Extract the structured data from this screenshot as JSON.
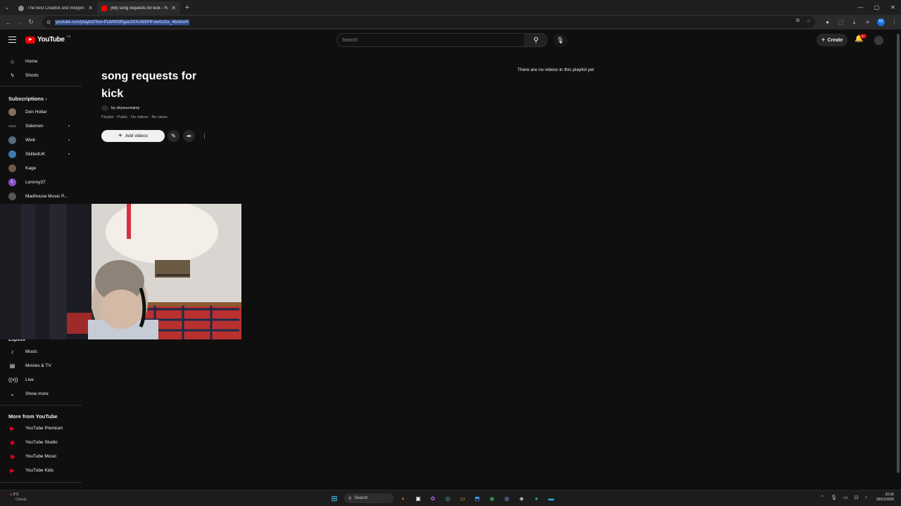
{
  "browser": {
    "tabs": [
      {
        "title": "The best ChatBot and Widgets"
      },
      {
        "title": "(68) song requests for kick - Yo"
      }
    ],
    "url": "youtube.com/playlist?list=PLWt9StRgax3XXU60lPiFowAUGx_4bAKwH"
  },
  "header": {
    "logo_text": "YouTube",
    "logo_country": "GB",
    "search_placeholder": "Search",
    "create_label": "Create",
    "notification_badge": "9+"
  },
  "sidebar": {
    "main": [
      {
        "label": "Home",
        "icon": "home-icon"
      },
      {
        "label": "Shorts",
        "icon": "shorts-icon"
      }
    ],
    "subscriptions_heading": "Subscriptions",
    "subscriptions": [
      {
        "label": "Don Hollar",
        "color": "#8a6a5a",
        "dot": false
      },
      {
        "label": "Sidemen",
        "color": "#444444",
        "dot": true
      },
      {
        "label": "Wixk",
        "color": "#5a6a7a",
        "dot": true
      },
      {
        "label": "SkilledUK",
        "color": "#3a7ab0",
        "dot": true
      },
      {
        "label": "Kage",
        "color": "#6a5a4a",
        "dot": false
      },
      {
        "label": "Lennny37",
        "color": "#8a4fc9",
        "dot": false,
        "initial": "L"
      },
      {
        "label": "Madhouse Music P...",
        "color": "#555555",
        "dot": false
      }
    ],
    "explore_heading": "Explore",
    "explore": [
      {
        "label": "Music",
        "icon": "music-icon"
      },
      {
        "label": "Movies & TV",
        "icon": "movies-icon"
      },
      {
        "label": "Live",
        "icon": "live-icon"
      },
      {
        "label": "Show more",
        "icon": "chevron-down-icon"
      }
    ],
    "more_heading": "More from YouTube",
    "more": [
      {
        "label": "YouTube Premium",
        "color": "#ff0033"
      },
      {
        "label": "YouTube Studio",
        "color": "#ff0033"
      },
      {
        "label": "YouTube Music",
        "color": "#ff0033"
      },
      {
        "label": "YouTube Kids",
        "color": "#ff0033"
      }
    ]
  },
  "playlist": {
    "title_line1": "song requests for",
    "title_line2": "kick",
    "owner": "by ohyoucreamy",
    "meta": "Playlist · Public · No videos · No views",
    "add_videos_label": "Add videos",
    "empty_message": "There are no videos in this playlist yet"
  },
  "taskbar": {
    "weather_temp": "2°C",
    "weather_desc": "Cloudy",
    "search_label": "Search",
    "time": "20:36",
    "date": "06/01/2026"
  },
  "colors": {
    "accent_red": "#ff0000",
    "background": "#0f0f0f",
    "link_blue": "#3ea6ff"
  }
}
